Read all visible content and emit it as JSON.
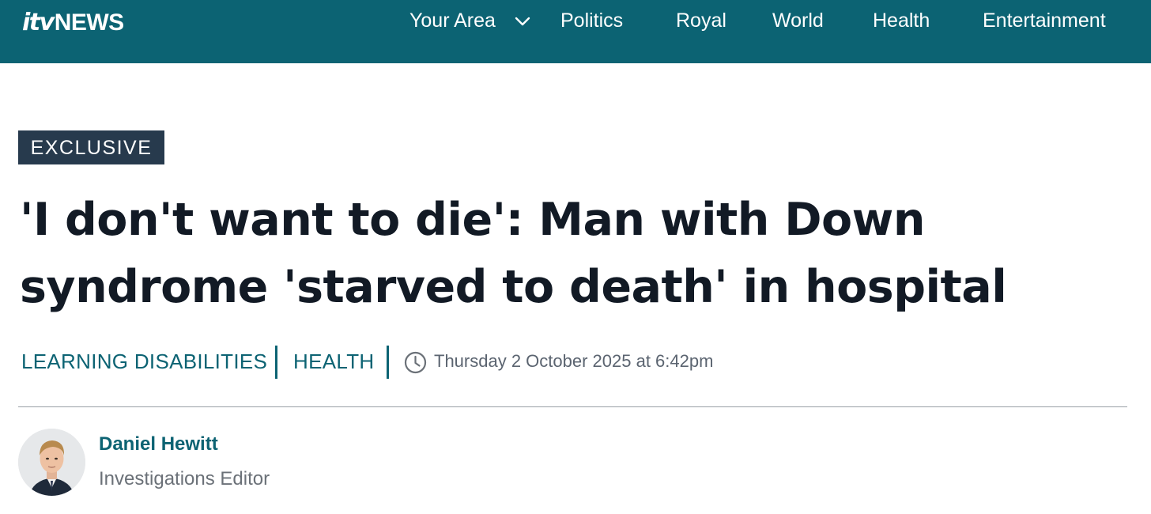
{
  "brand": {
    "logo_itv": "itv",
    "logo_news": "NEWS",
    "header_color": "#0c6373"
  },
  "nav": {
    "your_area": "Your Area",
    "politics": "Politics",
    "royal": "Royal",
    "world": "World",
    "health": "Health",
    "entertainment": "Entertainment"
  },
  "article": {
    "badge": "EXCLUSIVE",
    "headline": "'I don't want to die': Man with Down syndrome 'starved to death' in hospital",
    "tags": [
      "LEARNING DISABILITIES",
      "HEALTH"
    ],
    "date": "Thursday 2 October 2025 at 6:42pm"
  },
  "author": {
    "name": "Daniel Hewitt",
    "role": "Investigations Editor"
  },
  "icons": [
    "chevron-down-icon",
    "clock-icon"
  ]
}
